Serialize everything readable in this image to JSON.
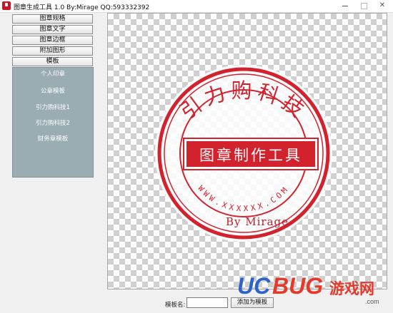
{
  "window": {
    "title": "图章生成工具 1.0    By:Mirage    QQ:593332392"
  },
  "sidebar": {
    "buttons": [
      "图章规格",
      "图章文字",
      "图章边框",
      "附加图形",
      "模板"
    ],
    "templates": [
      "个人印章",
      "公章模板",
      "引力购科技1",
      "引力购科技2",
      "财务章模板"
    ]
  },
  "stamp": {
    "arc_text": "引力购科技",
    "banner_text": "图章制作工具",
    "bottom_arc_text": "WWW.XXXXXX.COM",
    "signature": "By Mirage",
    "color": "#d2222d"
  },
  "footer": {
    "name_label": "模板名:",
    "name_value": "",
    "add_button": "添加为模板"
  },
  "watermark": {
    "brand_left": "UC",
    "brand_right": "BUG",
    "brand_cn": "游戏网",
    "domain": ".com"
  }
}
